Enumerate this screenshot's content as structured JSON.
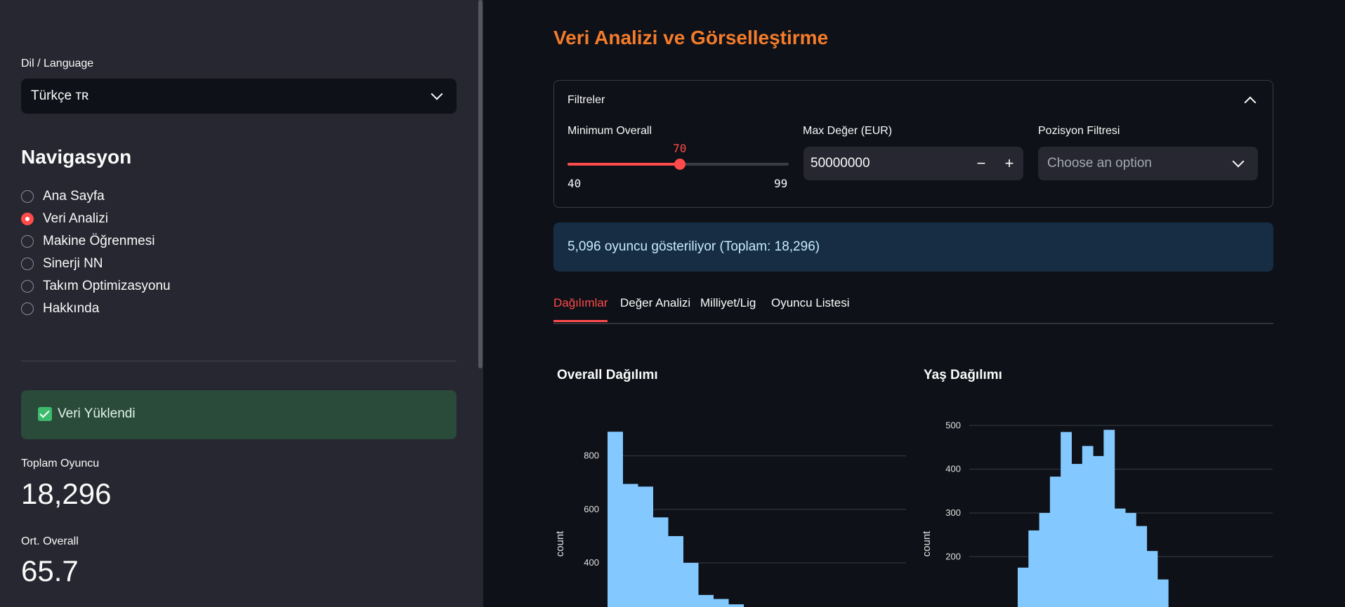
{
  "sidebar": {
    "language_label": "Dil / Language",
    "language_value": "Türkçe ᴛʀ",
    "nav_title": "Navigasyon",
    "nav_items": [
      {
        "label": "Ana Sayfa",
        "selected": false
      },
      {
        "label": "Veri Analizi",
        "selected": true
      },
      {
        "label": "Makine Öğrenmesi",
        "selected": false
      },
      {
        "label": "Sinerji NN",
        "selected": false
      },
      {
        "label": "Takım Optimizasyonu",
        "selected": false
      },
      {
        "label": "Hakkında",
        "selected": false
      }
    ],
    "status": "Veri Yüklendi",
    "metrics": [
      {
        "label": "Toplam Oyuncu",
        "value": "18,296"
      },
      {
        "label": "Ort. Overall",
        "value": "65.7"
      }
    ]
  },
  "main": {
    "title": "Veri Analizi ve Görselleştirme",
    "filters": {
      "header": "Filtreler",
      "min_overall_label": "Minimum Overall",
      "min_overall_value": 70,
      "min_overall_min": 40,
      "min_overall_max": 99,
      "max_value_label": "Max Değer (EUR)",
      "max_value": "50000000",
      "minus": "−",
      "plus": "+",
      "position_label": "Pozisyon Filtresi",
      "position_placeholder": "Choose an option"
    },
    "info": "5,096 oyuncu gösteriliyor (Toplam: 18,296)",
    "tabs": [
      "Dağılımlar",
      "Değer Analizi",
      "Milliyet/Lig",
      "Oyuncu Listesi"
    ],
    "active_tab": 0
  },
  "colors": {
    "accent": "#ff4b4b",
    "title": "#f47c2a",
    "bar": "#83c9ff"
  },
  "chart_data": [
    {
      "type": "bar",
      "title": "Overall Dağılımı",
      "ylabel": "count",
      "yticks": [
        400,
        600,
        800
      ],
      "ylim_visible": [
        235,
        930
      ],
      "values": [
        890,
        695,
        685,
        570,
        500,
        400,
        280,
        265,
        245
      ]
    },
    {
      "type": "bar",
      "title": "Yaş Dağılımı",
      "ylabel": "count",
      "yticks": [
        200,
        300,
        400,
        500
      ],
      "ylim_visible": [
        85,
        510
      ],
      "values": [
        175,
        260,
        300,
        383,
        485,
        412,
        453,
        430,
        490,
        310,
        300,
        270,
        213,
        148
      ]
    }
  ]
}
